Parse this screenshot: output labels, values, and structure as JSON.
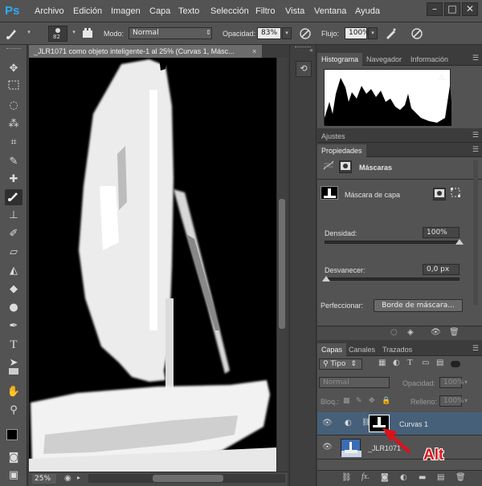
{
  "app": {
    "logo": "Ps"
  },
  "menu": [
    "Archivo",
    "Edición",
    "Imagen",
    "Capa",
    "Texto",
    "Selección",
    "Filtro",
    "Vista",
    "Ventana",
    "Ayuda"
  ],
  "window_controls": [
    "–",
    "□",
    "✕"
  ],
  "options": {
    "brush_size": "82",
    "mode_label": "Modo:",
    "mode_value": "Normal",
    "opacity_label": "Opacidad:",
    "opacity_value": "83%",
    "flow_label": "Flujo:",
    "flow_value": "100%"
  },
  "document": {
    "tab_title": "_JLR1071 como objeto inteligente-1 al 25% (Curvas 1, Másc...",
    "zoom": "25%"
  },
  "histogram_panel": {
    "tabs": [
      "Histograma",
      "Navegador",
      "Información"
    ],
    "warning_icon": "warning-icon"
  },
  "adjustments_panel": {
    "tab": "Ajustes"
  },
  "properties_panel": {
    "tab": "Propiedades",
    "section_title": "Máscaras",
    "mask_label": "Máscara de capa",
    "density_label": "Densidad:",
    "density_value": "100%",
    "density_fraction": 1.0,
    "feather_label": "Desvanecer:",
    "feather_value": "0,0 px",
    "feather_fraction": 0.0,
    "refine_label": "Perfeccionar:",
    "refine_button": "Borde de máscara..."
  },
  "layers_panel": {
    "tabs": [
      "Capas",
      "Canales",
      "Trazados"
    ],
    "filter_kind": "Tipo",
    "blend_mode": "Normal",
    "opacity_label": "Opacidad:",
    "opacity_value": "100%",
    "lock_label": "Bloq.:",
    "fill_label": "Relleno:",
    "fill_value": "100%",
    "layers": [
      {
        "name": "Curvas 1",
        "selected": true
      },
      {
        "name": "_JLR1071",
        "selected": false
      }
    ],
    "annotation": "Alt"
  },
  "colors": {
    "annotation_red": "#e0101a",
    "selection_blue": "#46607a",
    "ps_blue": "#31a8ff"
  }
}
